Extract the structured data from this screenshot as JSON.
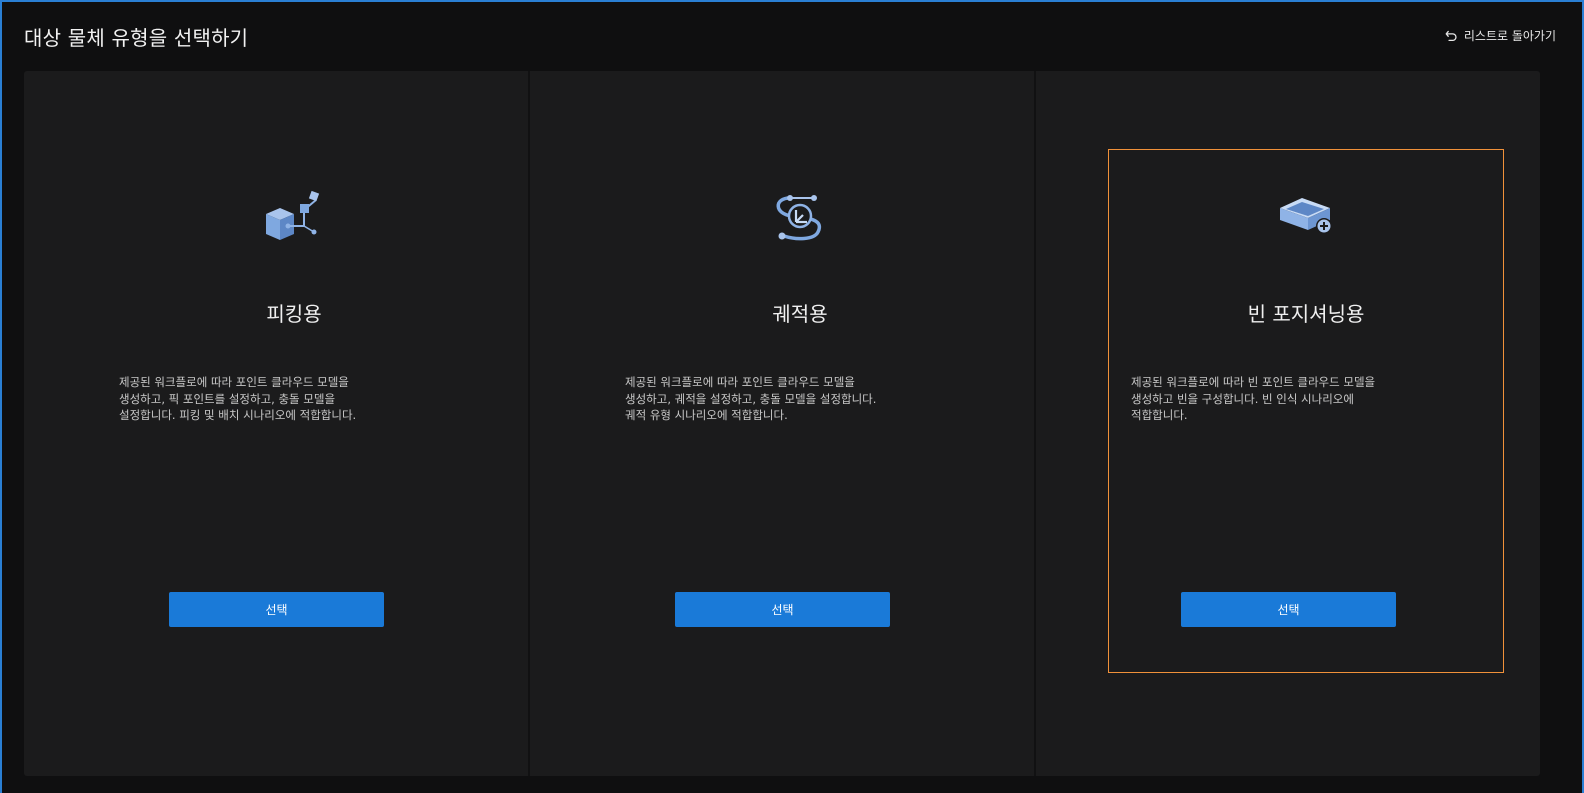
{
  "header": {
    "title": "대상 물체 유형을 선택하기",
    "back_label": "리스트로 돌아가기",
    "back_icon": "undo-arrow-icon"
  },
  "colors": {
    "accent": "#1a7ad8",
    "selected_border": "#f0913a",
    "icon_blue": "#7fa8e0"
  },
  "cards": [
    {
      "title": "피킹용",
      "description": "제공된 워크플로에 따라 포인트 클라우드 모델을\n생성하고, 픽 포인트를 설정하고, 충돌 모델을\n설정합니다. 피킹 및 배치 시나리오에 적합합니다.",
      "button_label": "선택",
      "icon": "box-picking-icon",
      "selected": false
    },
    {
      "title": "궤적용",
      "description": "제공된 워크플로에 따라 포인트 클라우드 모델을\n생성하고, 궤적을 설정하고, 충돌 모델을 설정합니다.\n궤적 유형 시나리오에 적합합니다.",
      "button_label": "선택",
      "icon": "trajectory-icon",
      "selected": false
    },
    {
      "title": "빈 포지셔닝용",
      "description": "제공된 워크플로에 따라 빈 포인트 클라우드 모델을\n생성하고 빈을 구성합니다. 빈 인식 시나리오에\n적합합니다.",
      "button_label": "선택",
      "icon": "bin-add-icon",
      "selected": true
    }
  ]
}
